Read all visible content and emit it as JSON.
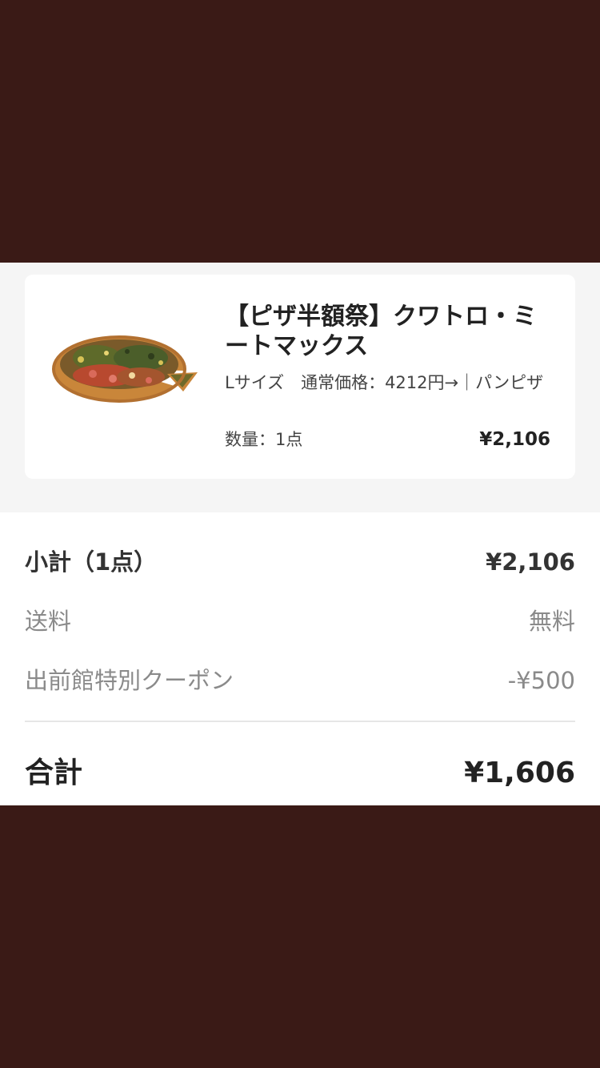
{
  "colors": {
    "background_dark": "#3a1a16",
    "card_background": "#ffffff",
    "section_background": "#f5f5f5",
    "text_primary": "#222222",
    "text_muted": "#8a8a8a"
  },
  "order_item": {
    "image_icon": "pizza-image",
    "title": "【ピザ半額祭】クワトロ・ミートマックス",
    "description": "Lサイズ　通常価格：4212円→｜パンピザ",
    "quantity": "数量：1点",
    "price": "¥2,106"
  },
  "summary": {
    "subtotal_label": "小計（1点）",
    "subtotal_value": "¥2,106",
    "shipping_label": "送料",
    "shipping_value": "無料",
    "coupon_label": "出前館特別クーポン",
    "coupon_value": "-¥500",
    "total_label": "合計",
    "total_value": "¥1,606"
  }
}
